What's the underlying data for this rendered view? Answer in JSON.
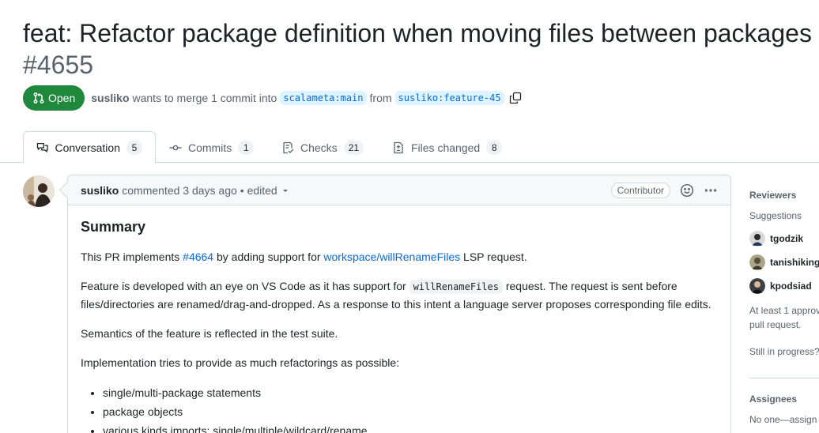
{
  "pr": {
    "title": "feat: Refactor package definition when moving files between packages",
    "number": "#4655",
    "state": "Open",
    "author": "susliko",
    "merge_text": "wants to merge 1 commit into",
    "base_branch": "scalameta:main",
    "from_text": "from",
    "head_branch": "susliko:feature-45"
  },
  "tabs": [
    {
      "label": "Conversation",
      "count": "5",
      "icon": "comment-discussion-icon"
    },
    {
      "label": "Commits",
      "count": "1",
      "icon": "git-commit-icon"
    },
    {
      "label": "Checks",
      "count": "21",
      "icon": "checklist-icon"
    },
    {
      "label": "Files changed",
      "count": "8",
      "icon": "file-diff-icon"
    }
  ],
  "comment": {
    "author": "susliko",
    "meta": "commented 3 days ago",
    "edited": "• edited",
    "role": "Contributor",
    "heading": "Summary",
    "p1_pre": "This PR implements",
    "p1_link1": "#4664",
    "p1_mid": "by adding support for",
    "p1_link2": "workspace/willRenameFiles",
    "p1_post": "LSP request.",
    "p2_pre": "Feature is developed with an eye on VS Code as it has support for",
    "p2_code": "willRenameFiles",
    "p2_post": "request. The request is sent before files/directories are renamed/drag-and-dropped. As a response to this intent a language server proposes corresponding file edits.",
    "p3": "Semantics of the feature is reflected in the test suite.",
    "p4": "Implementation tries to provide as much refactorings as possible:",
    "list": [
      "single/multi-package statements",
      "package objects",
      "various kinds imports: single/multiple/wildcard/rename"
    ]
  },
  "sidebar": {
    "reviewers_title": "Reviewers",
    "suggestions_label": "Suggestions",
    "reviewers": [
      "tgodzik",
      "tanishiking",
      "kpodsiad"
    ],
    "approval_text_1": "At least 1 approv",
    "approval_text_2": "pull request.",
    "progress_text": "Still in progress?",
    "assignees_title": "Assignees",
    "assignees_text": "No one—assign"
  },
  "colors": {
    "open_green": "#1f883d",
    "link_blue": "#0969da",
    "branch_bg": "#ddf4ff"
  }
}
